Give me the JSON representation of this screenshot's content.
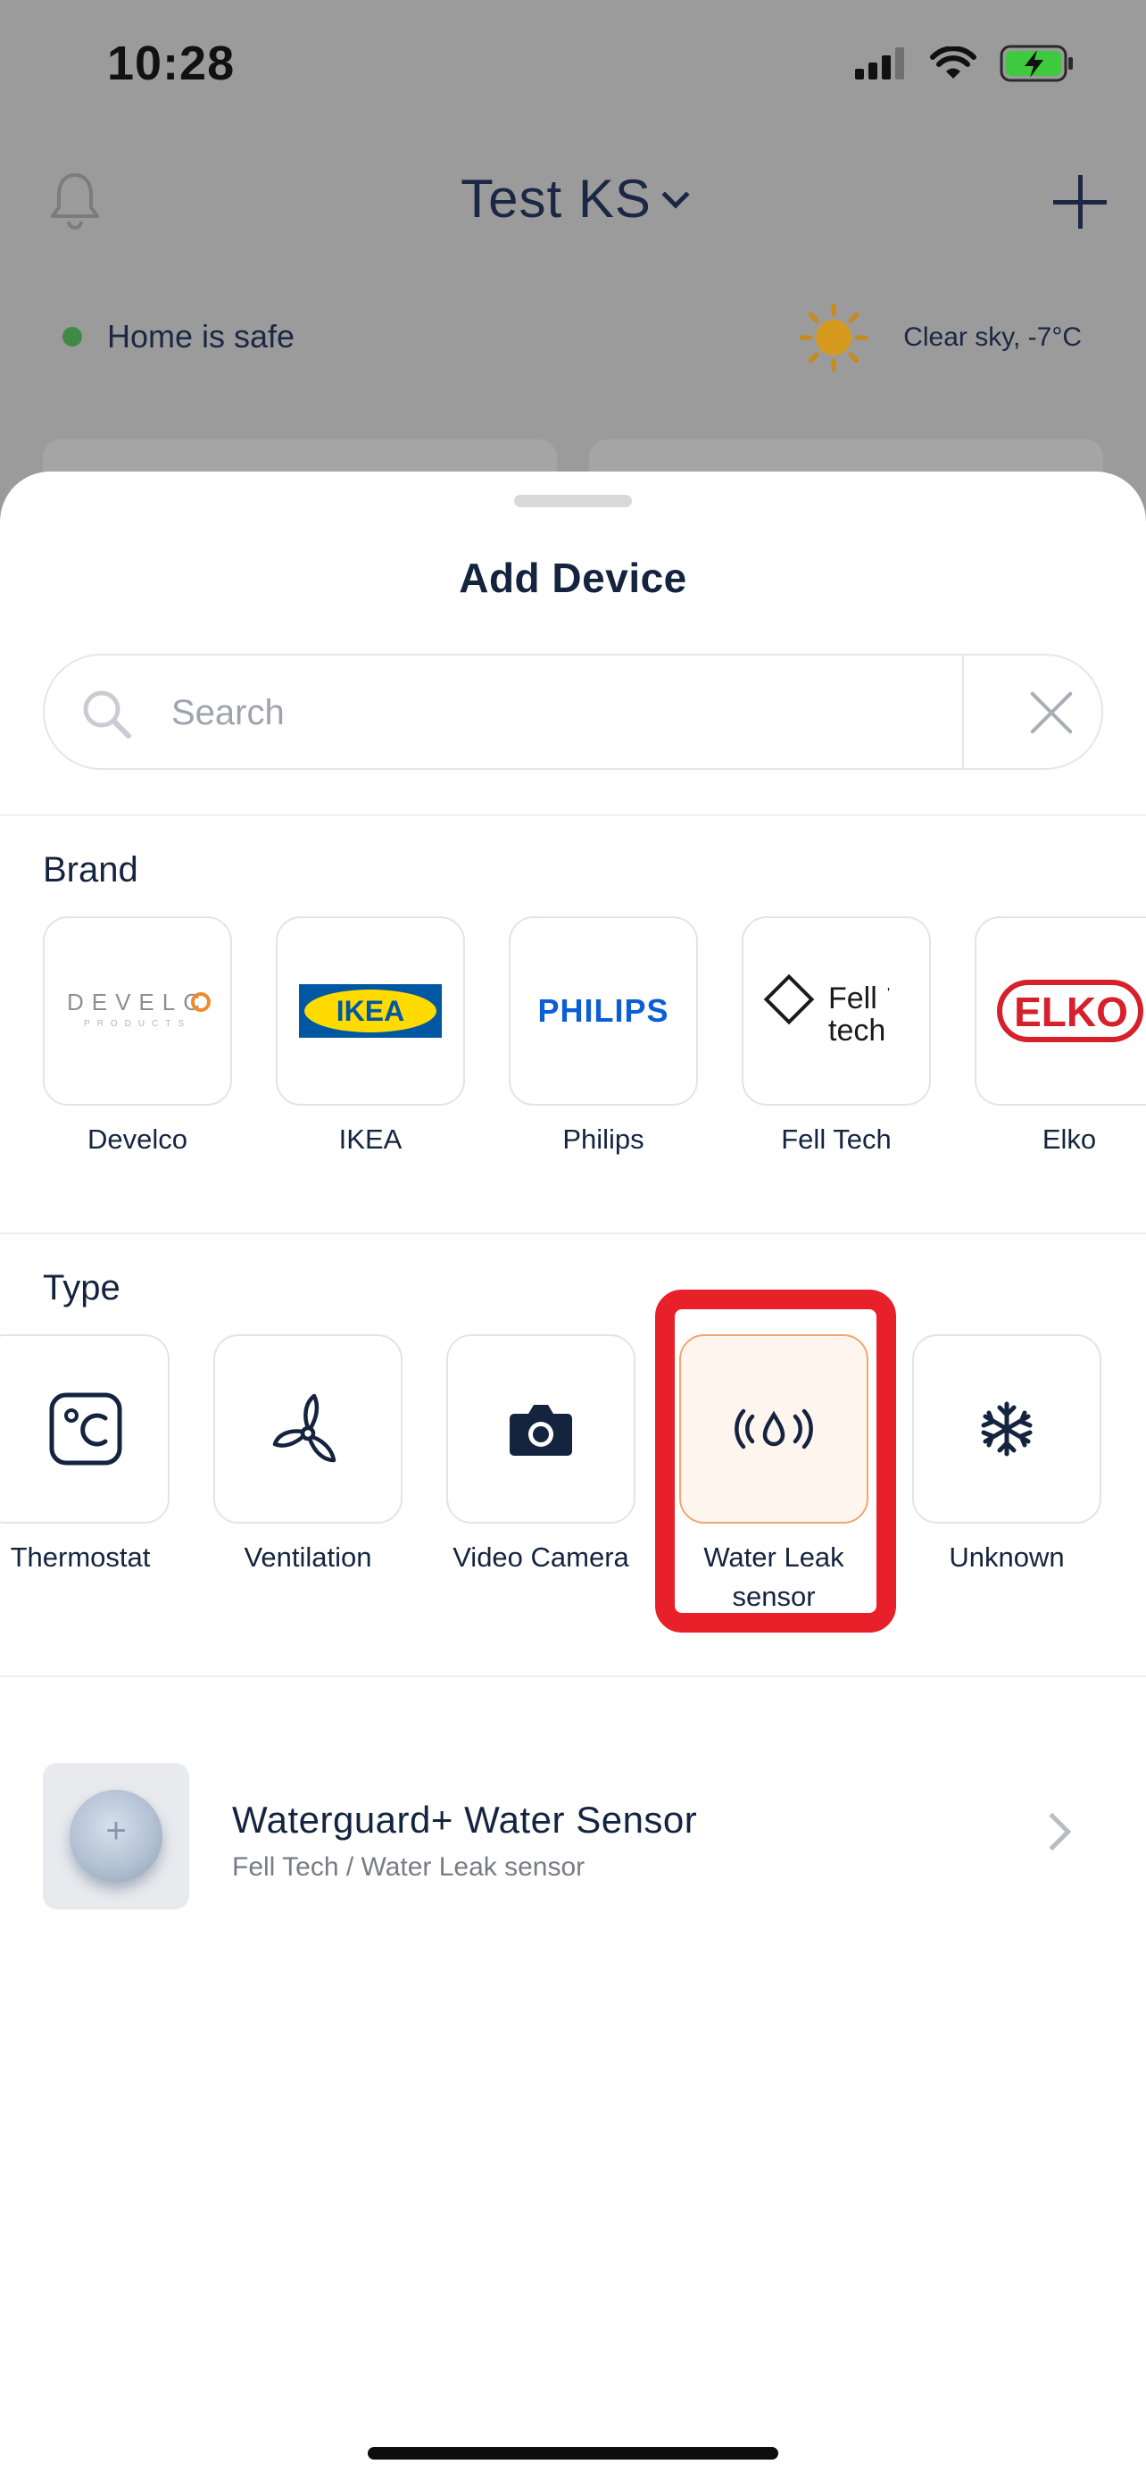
{
  "status_bar": {
    "time": "10:28"
  },
  "home": {
    "title": "Test KS",
    "safe_status": "Home is safe",
    "weather": "Clear sky, -7°C"
  },
  "sheet": {
    "title": "Add Device",
    "search": {
      "placeholder": "Search",
      "value": ""
    },
    "brand_label": "Brand",
    "brands": [
      {
        "name": "Develco",
        "logo_text": "DEVELCO",
        "logo_sub": "PRODUCTS"
      },
      {
        "name": "IKEA",
        "logo_text": "IKEA"
      },
      {
        "name": "Philips",
        "logo_text": "PHILIPS"
      },
      {
        "name": "Fell Tech",
        "logo_text": "Fell tech"
      },
      {
        "name": "Elko",
        "logo_text": "ELKO"
      }
    ],
    "type_label": "Type",
    "types": [
      {
        "name": "Thermostat",
        "icon": "thermostat-icon"
      },
      {
        "name": "Ventilation",
        "icon": "fan-icon"
      },
      {
        "name": "Video Camera",
        "icon": "camera-icon"
      },
      {
        "name_line1": "Water Leak",
        "name_line2": "sensor",
        "icon": "water-leak-icon",
        "selected": true
      },
      {
        "name": "Unknown",
        "icon": "snowflake-icon"
      }
    ],
    "results": [
      {
        "name": "Waterguard+ Water Sensor",
        "subtitle": "Fell Tech / Water Leak sensor"
      }
    ]
  },
  "colors": {
    "accent_highlight": "#e8202a",
    "selected_bg": "#fff5ef",
    "selected_border": "#f0a66e",
    "safe_green": "#3f8a45",
    "ikea_blue": "#0058a3",
    "ikea_yellow": "#ffdb00",
    "philips_blue": "#0b5ed7",
    "elko_red": "#d6202c",
    "develco_orange": "#f08a2a"
  }
}
